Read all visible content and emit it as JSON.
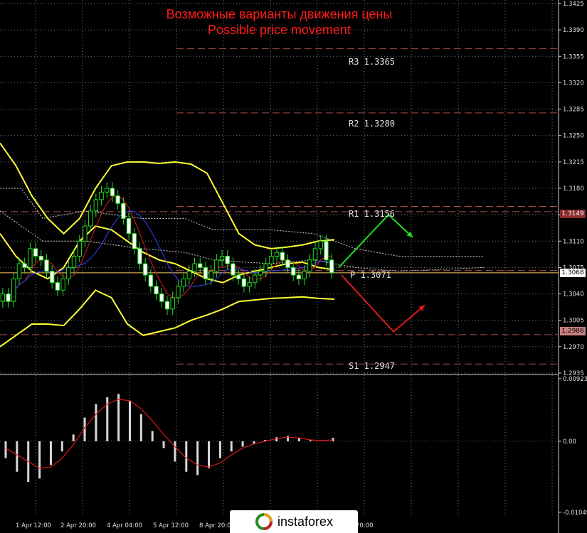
{
  "title_ru": "Возможные варианты движения цены",
  "title_en": "Possible price movement",
  "levels": {
    "r3": "R3 1.3365",
    "r2": "R2 1.3280",
    "r1": "R1 1.3156",
    "p": "P 1.3071",
    "s1": "S1 1.2947"
  },
  "price_tags": {
    "upper": "1.3149",
    "current": "1.3068",
    "lower": "1.2986"
  },
  "colors": {
    "background": "#000000",
    "title": "#ff1a1a",
    "bollinger": "#ffff33",
    "up_arrow": "#22dd22",
    "down_arrow": "#dd1a1a",
    "level_line": "#b04a4a"
  },
  "logo": {
    "text": "instaforex",
    "icon": "instaforex-ring-icon"
  },
  "chart_data": {
    "type": "line",
    "subtype": "candlestick",
    "price_axis": {
      "min": 1.2935,
      "max": 1.3425,
      "ticks": [
        "1.3425",
        "1.3390",
        "1.3355",
        "1.3320",
        "1.3285",
        "1.3250",
        "1.3215",
        "1.3180",
        "1.3145",
        "1.3110",
        "1.3075",
        "1.3040",
        "1.3005",
        "1.2970",
        "1.2935"
      ]
    },
    "time_axis": {
      "labels": [
        "1 Apr 12:00",
        "2 Apr 20:00",
        "4 Apr 04:00",
        "5 Apr 12:00",
        "8 Apr 20:00",
        "20:00"
      ]
    },
    "oscillator_axis": {
      "min": -0.0104,
      "max": 0.00923,
      "ticks": [
        "0.00923",
        "0.00",
        "-0.01049"
      ]
    },
    "pivot_levels": [
      {
        "name": "R3",
        "value": 1.3365
      },
      {
        "name": "R2",
        "value": 1.328
      },
      {
        "name": "R1",
        "value": 1.3156
      },
      {
        "name": "P",
        "value": 1.3071
      },
      {
        "name": "S1",
        "value": 1.2947
      }
    ],
    "closes": [
      1.304,
      1.303,
      1.306,
      1.308,
      1.3075,
      1.31,
      1.309,
      1.3085,
      1.307,
      1.3055,
      1.3045,
      1.306,
      1.3075,
      1.309,
      1.311,
      1.313,
      1.315,
      1.3165,
      1.3175,
      1.318,
      1.317,
      1.316,
      1.314,
      1.312,
      1.31,
      1.308,
      1.3065,
      1.305,
      1.304,
      1.303,
      1.302,
      1.3035,
      1.305,
      1.306,
      1.307,
      1.308,
      1.3075,
      1.306,
      1.307,
      1.3085,
      1.309,
      1.308,
      1.3065,
      1.306,
      1.305,
      1.3055,
      1.3065,
      1.307,
      1.308,
      1.309,
      1.3095,
      1.3085,
      1.3075,
      1.3065,
      1.306,
      1.307,
      1.3085,
      1.31,
      1.311,
      1.3085,
      1.3068
    ],
    "bb_upper": [
      1.324,
      1.321,
      1.317,
      1.314,
      1.312,
      1.314,
      1.318,
      1.321,
      1.3215,
      1.3215,
      1.3213,
      1.3215,
      1.3212,
      1.32,
      1.316,
      1.312,
      1.3105,
      1.31,
      1.3102,
      1.3105,
      1.311,
      1.3112
    ],
    "bb_middle": [
      1.312,
      1.309,
      1.307,
      1.306,
      1.3075,
      1.311,
      1.313,
      1.3125,
      1.311,
      1.3095,
      1.3085,
      1.308,
      1.307,
      1.306,
      1.3055,
      1.3065,
      1.307,
      1.3075,
      1.308,
      1.3082,
      1.3075,
      1.3072
    ],
    "bb_lower": [
      1.297,
      1.2985,
      1.3,
      1.3,
      1.2998,
      1.302,
      1.3045,
      1.3035,
      1.3,
      1.2985,
      1.299,
      1.2995,
      1.3005,
      1.3012,
      1.302,
      1.303,
      1.3032,
      1.3034,
      1.3035,
      1.3036,
      1.3034,
      1.3033
    ],
    "histogram": [
      -0.0025,
      -0.0045,
      -0.006,
      -0.0055,
      -0.0035,
      -0.0015,
      0.001,
      0.0035,
      0.0055,
      0.0065,
      0.007,
      0.006,
      0.004,
      0.0015,
      -0.001,
      -0.003,
      -0.0045,
      -0.005,
      -0.004,
      -0.0025,
      -0.0015,
      -0.0008,
      -0.0004,
      0.0002,
      0.0006,
      0.0008,
      0.0005,
      0.0002,
      0.0001,
      0.0005
    ],
    "signal": [
      -0.001,
      -0.002,
      -0.003,
      -0.004,
      -0.0038,
      -0.0025,
      -0.0005,
      0.002,
      0.004,
      0.0055,
      0.0062,
      0.006,
      0.0048,
      0.003,
      0.001,
      -0.0008,
      -0.0025,
      -0.0035,
      -0.0038,
      -0.0032,
      -0.002,
      -0.001,
      -0.0004,
      0.0,
      0.0004,
      0.0006,
      0.0005,
      0.0002,
      0.0001,
      0.0002
    ]
  }
}
